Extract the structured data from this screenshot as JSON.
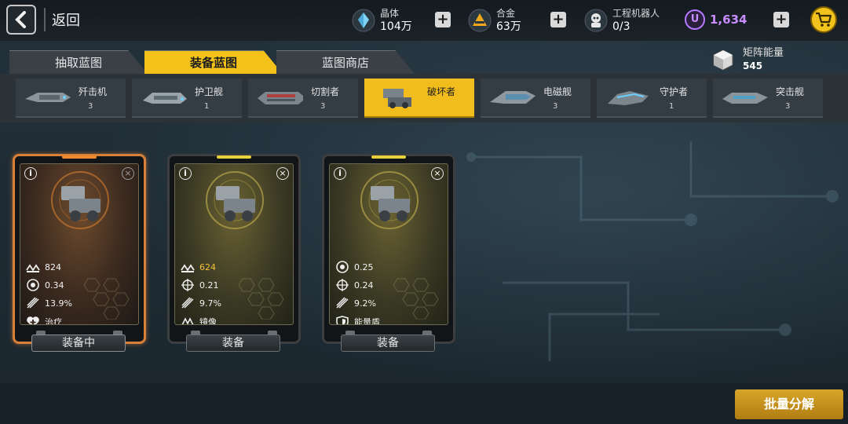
{
  "topbar": {
    "back_label": "返回",
    "resources": [
      {
        "label": "晶体",
        "value": "104万",
        "icon": "crystal-icon"
      },
      {
        "label": "合金",
        "value": "63万",
        "icon": "alloy-icon"
      },
      {
        "label": "工程机器人",
        "value": "0/3",
        "icon": "robot-icon"
      }
    ],
    "premium_currency": {
      "symbol": "U",
      "value": "1,634",
      "color": "#c98cff"
    },
    "shop_icon": "cart-icon"
  },
  "tabs": [
    {
      "label": "抽取蓝图",
      "active": false
    },
    {
      "label": "装备蓝图",
      "active": true
    },
    {
      "label": "蓝图商店",
      "active": false
    }
  ],
  "matrix_energy": {
    "label": "矩阵能量",
    "value": "545"
  },
  "ship_types": [
    {
      "name": "歼击机",
      "count": "3",
      "active": false
    },
    {
      "name": "护卫舰",
      "count": "1",
      "active": false
    },
    {
      "name": "切割者",
      "count": "3",
      "active": false
    },
    {
      "name": "破坏者",
      "count": "",
      "active": true
    },
    {
      "name": "电磁舰",
      "count": "3",
      "active": false
    },
    {
      "name": "守护者",
      "count": "1",
      "active": false
    },
    {
      "name": "突击舰",
      "count": "3",
      "active": false
    }
  ],
  "cards": [
    {
      "equipped": true,
      "stats": [
        {
          "icon": "attack-icon",
          "value": "824",
          "highlight": false
        },
        {
          "icon": "crit-icon",
          "value": "0.34",
          "highlight": false
        },
        {
          "icon": "missile-icon",
          "value": "13.9%",
          "highlight": false
        }
      ],
      "skill": {
        "icon": "heal-icon",
        "label": "治疗"
      },
      "button_label": "装备中"
    },
    {
      "equipped": false,
      "stats": [
        {
          "icon": "attack-icon",
          "value": "624",
          "highlight": true
        },
        {
          "icon": "crosshair-icon",
          "value": "0.21",
          "highlight": false
        },
        {
          "icon": "missile-icon",
          "value": "9.7%",
          "highlight": false
        }
      ],
      "skill": {
        "icon": "mirror-icon",
        "label": "镜像"
      },
      "button_label": "装备"
    },
    {
      "equipped": false,
      "stats": [
        {
          "icon": "crit-icon",
          "value": "0.25",
          "highlight": false
        },
        {
          "icon": "crosshair-icon",
          "value": "0.24",
          "highlight": false
        },
        {
          "icon": "missile-icon",
          "value": "9.2%",
          "highlight": false
        }
      ],
      "skill": {
        "icon": "shield-icon",
        "label": "能量盾"
      },
      "button_label": "装备"
    }
  ],
  "batch_button_label": "批量分解",
  "colors": {
    "accent": "#f2c11a",
    "equipped": "#d7803a"
  }
}
